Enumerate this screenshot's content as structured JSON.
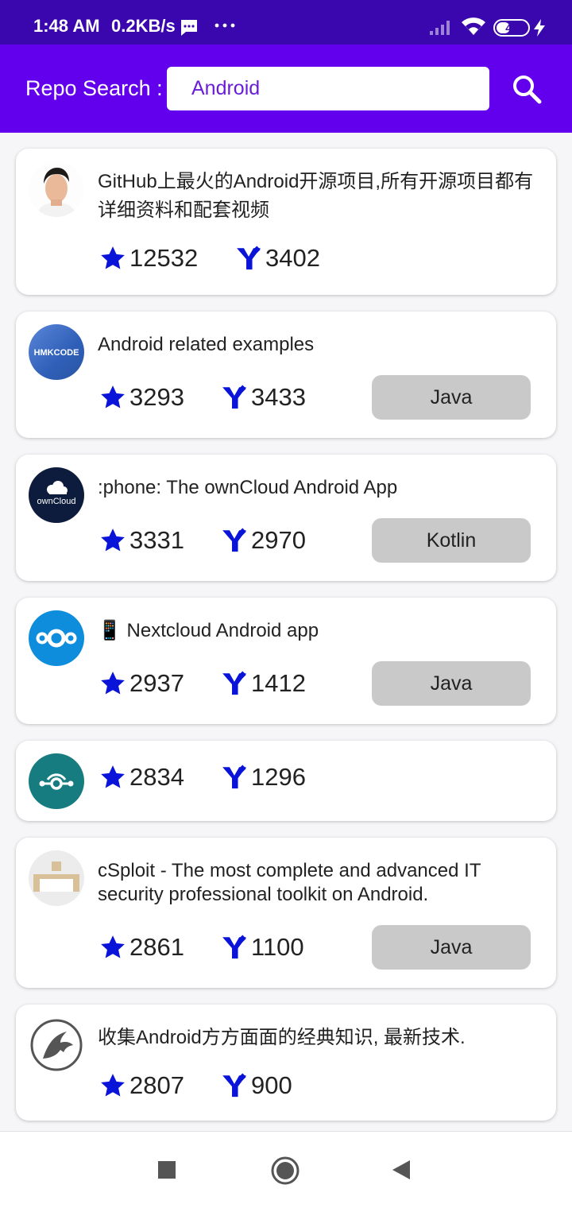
{
  "status_bar": {
    "time": "1:48 AM",
    "speed": "0.2KB/s",
    "battery": "46",
    "battery_fraction": 0.46,
    "icons": [
      "message-icon",
      "more-dots-icon",
      "signal-icon",
      "wifi-icon",
      "battery-icon",
      "charging-bolt-icon"
    ]
  },
  "app_bar": {
    "label": "Repo Search :",
    "search_value": "Android",
    "search_icon": "search-icon",
    "background": "#6200ee",
    "status_background": "#3a06ad"
  },
  "colors": {
    "stat_icon": "#0a14d8",
    "badge_bg": "#c9c9c9"
  },
  "repos": [
    {
      "description": "GitHub上最火的Android开源项目,所有开源项目都有详细资料和配套视频",
      "stars": "12532",
      "forks": "3402",
      "language": "",
      "avatar": "person-photo"
    },
    {
      "description": "Android related examples",
      "stars": "3293",
      "forks": "3433",
      "language": "Java",
      "avatar_text": "HMKCODE"
    },
    {
      "description": ":phone: The ownCloud Android App",
      "stars": "3331",
      "forks": "2970",
      "language": "Kotlin",
      "avatar_text": "ownCloud"
    },
    {
      "description": "📱 Nextcloud Android app",
      "stars": "2937",
      "forks": "1412",
      "language": "Java",
      "avatar": "nextcloud-logo"
    },
    {
      "description": "",
      "stars": "2834",
      "forks": "1296",
      "language": "",
      "avatar": "lineageos-logo"
    },
    {
      "description": "cSploit - The most complete and advanced IT security professional toolkit on Android.",
      "stars": "2861",
      "forks": "1100",
      "language": "Java",
      "avatar": "csploit-logo"
    },
    {
      "description": "收集Android方方面面的经典知识, 最新技术.",
      "stars": "2807",
      "forks": "900",
      "language": "",
      "avatar": "horse-logo"
    }
  ],
  "nav_bar": {
    "icons": [
      "recents-icon",
      "home-icon",
      "back-icon"
    ]
  }
}
